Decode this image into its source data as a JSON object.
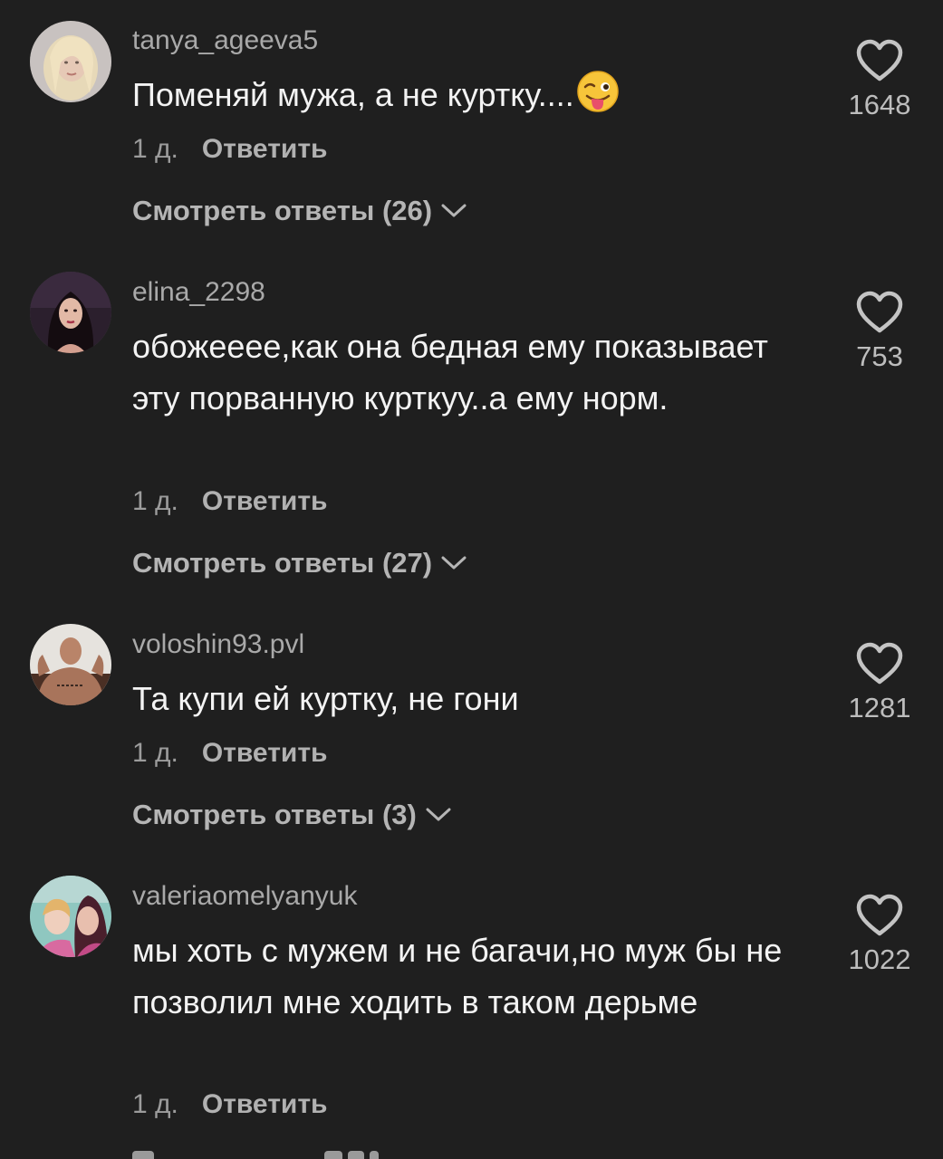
{
  "comments": [
    {
      "username": "tanya_ageeva5",
      "text": "Поменяй мужа, а не куртку....",
      "emoji": "winking-face-with-tongue",
      "age": "1 д.",
      "reply_label": "Ответить",
      "view_replies": "Смотреть ответы (26)",
      "likes": "1648"
    },
    {
      "username": "elina_2298",
      "text": "обожееее,как она бедная ему показывает эту порванную курткуу..а ему норм.",
      "age": "1 д.",
      "reply_label": "Ответить",
      "view_replies": "Смотреть ответы (27)",
      "likes": "753"
    },
    {
      "username": "voloshin93.pvl",
      "text": "Та купи ей куртку, не гони",
      "age": "1 д.",
      "reply_label": "Ответить",
      "view_replies": "Смотреть ответы (3)",
      "likes": "1281"
    },
    {
      "username": "valeriaomelyanyuk",
      "text": "мы хоть с мужем и не багачи,но муж бы не позволил мне ходить в таком дерьме",
      "age": "1 д.",
      "reply_label": "Ответить",
      "likes": "1022"
    }
  ],
  "colors": {
    "background": "#1f1f1f",
    "username": "#a9a9a9",
    "text": "#f3f3f3",
    "meta": "#9c9c9c"
  },
  "icons": {
    "like": "heart-outline-icon",
    "expand": "chevron-down-icon"
  }
}
